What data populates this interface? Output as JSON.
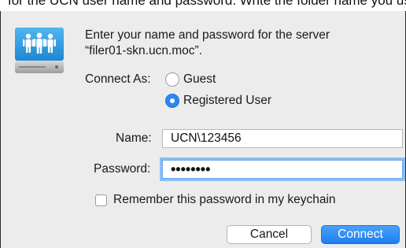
{
  "background_text": "for the UCN user name and password. Write the folder name you use",
  "dialog": {
    "prompt_line1": "Enter your name and password for the server",
    "prompt_line2": "“filer01-skn.ucn.moc”.",
    "server_icon": "network-server-icon",
    "connect_as_label": "Connect As:",
    "options": [
      {
        "label": "Guest",
        "selected": false
      },
      {
        "label": "Registered User",
        "selected": true
      }
    ],
    "name_label": "Name:",
    "name_value": "UCN\\123456",
    "password_label": "Password:",
    "password_value": "••••••••",
    "remember_label": "Remember this password in my keychain",
    "remember_checked": false,
    "cancel_label": "Cancel",
    "connect_label": "Connect",
    "accent_color": "#2b86f0"
  }
}
